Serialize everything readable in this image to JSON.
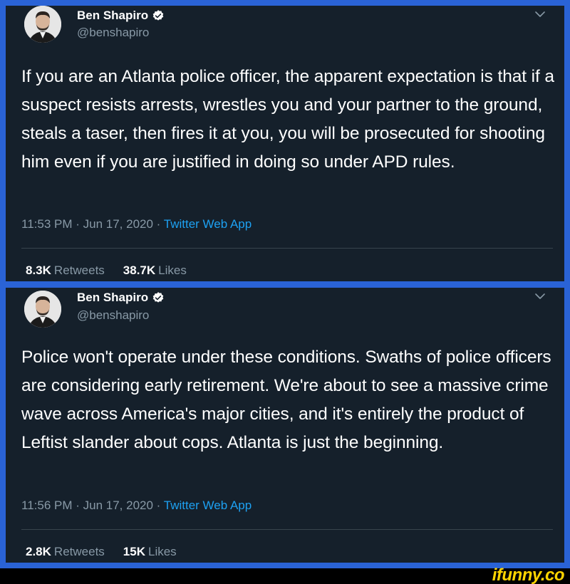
{
  "tweets": [
    {
      "author_name": "Ben Shapiro",
      "handle": "@benshapiro",
      "text": "If you are an Atlanta police officer, the apparent expectation is that if a suspect resists arrests, wrestles you and your partner to the ground, steals a taser, then fires it at you, you will be prosecuted for shooting him even if you are justified in doing so under APD rules.",
      "time": "11:53 PM",
      "date": "Jun 17, 2020",
      "app": "Twitter Web App",
      "retweets_count": "8.3K",
      "retweets_label": "Retweets",
      "likes_count": "38.7K",
      "likes_label": "Likes"
    },
    {
      "author_name": "Ben Shapiro",
      "handle": "@benshapiro",
      "text": "Police won't operate under these conditions. Swaths of police officers are considering early retirement. We're about to see a massive crime wave across America's major cities, and it's entirely the product of Leftist slander about cops. Atlanta is just the beginning.",
      "time": "11:56 PM",
      "date": "Jun 17, 2020",
      "app": "Twitter Web App",
      "retweets_count": "2.8K",
      "retweets_label": "Retweets",
      "likes_count": "15K",
      "likes_label": "Likes"
    }
  ],
  "separator": " · ",
  "watermark": "ifunny.co",
  "colors": {
    "background": "#15202b",
    "frame": "#2a63d6",
    "secondary_text": "#8899a6",
    "link": "#1da1f2",
    "verified": "#ffffff",
    "watermark": "#ffd400"
  },
  "icons": [
    "verified-badge-icon",
    "chevron-down-icon"
  ]
}
